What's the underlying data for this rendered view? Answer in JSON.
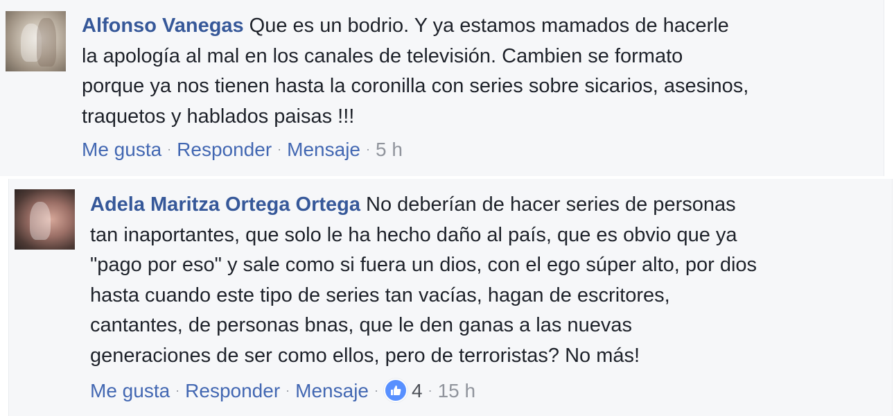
{
  "comments": [
    {
      "author": "Alfonso Vanegas",
      "lines": [
        "Que es un bodrio. Y ya estamos mamados de hacerle",
        "la apología al mal en los canales de televisión. Cambien se formato",
        "porque ya nos tienen hasta la coronilla con series sobre sicarios, asesinos,",
        "traquetos y hablados paisas !!!"
      ],
      "actions": {
        "like": "Me gusta",
        "reply": "Responder",
        "message": "Mensaje",
        "time": "5 h"
      }
    },
    {
      "author": "Adela Maritza Ortega Ortega",
      "lines": [
        "No deberían de hacer series de personas",
        "tan inaportantes, que solo le ha hecho daño al país, que es obvio que ya",
        "\"pago por eso\" y sale como si fuera un dios, con el ego súper alto, por dios",
        "hasta cuando este tipo de series tan vacías, hagan de escritores,",
        "cantantes, de personas bnas, que le den ganas a las nuevas",
        "generaciones de ser como ellos, pero de terroristas? No más!"
      ],
      "actions": {
        "like": "Me gusta",
        "reply": "Responder",
        "message": "Mensaje",
        "reaction_icon": "thumbs-up-icon",
        "reaction_count": "4",
        "time": "15 h"
      }
    }
  ],
  "colors": {
    "author": "#365899",
    "action_link": "#4267b2",
    "meta": "#90949c",
    "body_text": "#1d2129",
    "background": "#f6f7f9",
    "like_badge": "#5890ff"
  }
}
